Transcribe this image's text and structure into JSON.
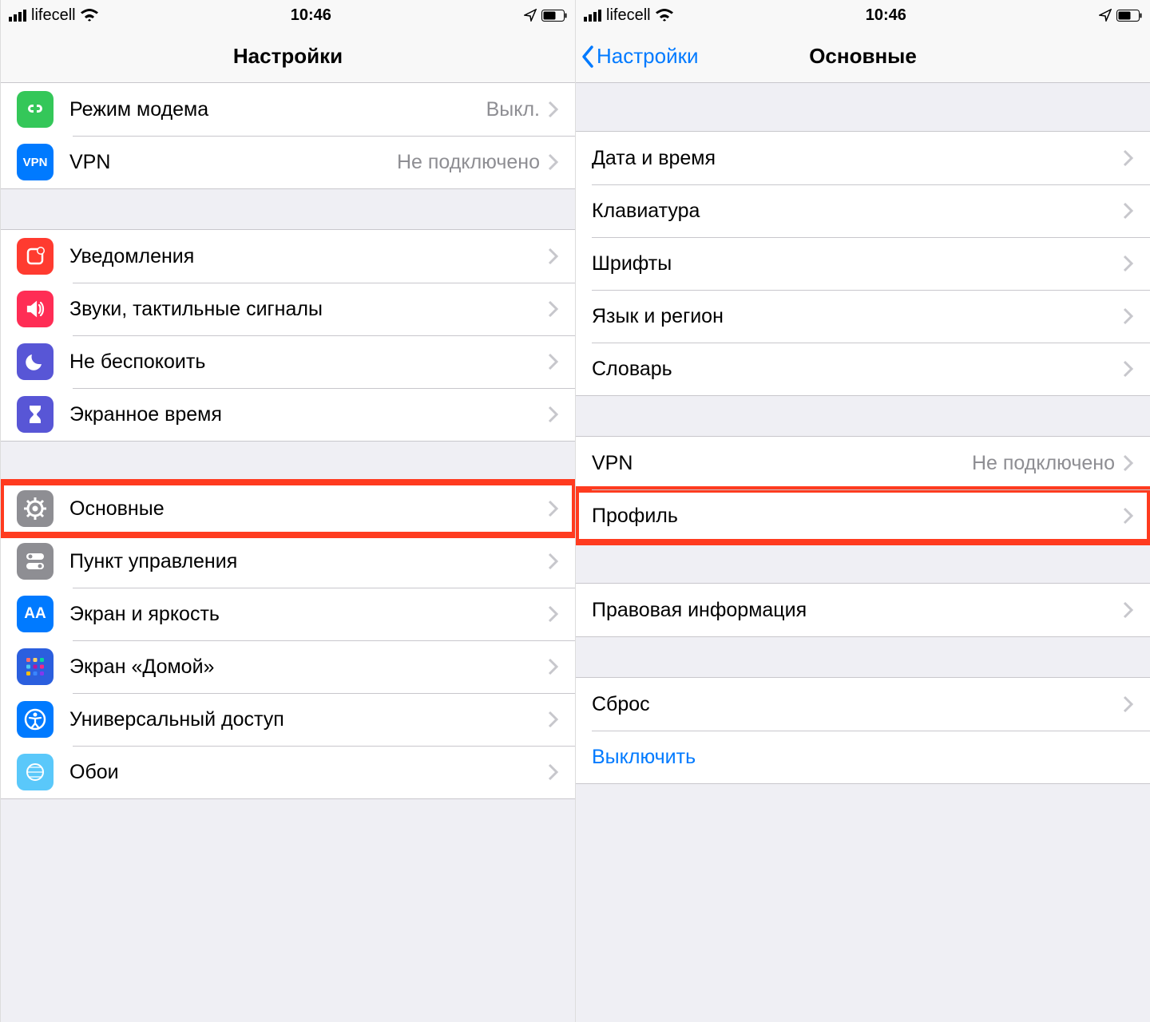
{
  "status": {
    "carrier": "lifecell",
    "time": "10:46"
  },
  "left": {
    "title": "Настройки",
    "items": {
      "hotspot": {
        "label": "Режим модема",
        "value": "Выкл."
      },
      "vpn": {
        "label": "VPN",
        "value": "Не подключено"
      },
      "notif": {
        "label": "Уведомления"
      },
      "sounds": {
        "label": "Звуки, тактильные сигналы"
      },
      "dnd": {
        "label": "Не беспокоить"
      },
      "screentime": {
        "label": "Экранное время"
      },
      "general": {
        "label": "Основные"
      },
      "control": {
        "label": "Пункт управления"
      },
      "display": {
        "label": "Экран и яркость"
      },
      "home": {
        "label": "Экран «Домой»"
      },
      "accessibility": {
        "label": "Универсальный доступ"
      },
      "wallpaper": {
        "label": "Обои"
      }
    }
  },
  "right": {
    "back": "Настройки",
    "title": "Основные",
    "items": {
      "datetime": {
        "label": "Дата и время"
      },
      "keyboard": {
        "label": "Клавиатура"
      },
      "fonts": {
        "label": "Шрифты"
      },
      "lang": {
        "label": "Язык и регион"
      },
      "dict": {
        "label": "Словарь"
      },
      "vpn": {
        "label": "VPN",
        "value": "Не подключено"
      },
      "profile": {
        "label": "Профиль"
      },
      "legal": {
        "label": "Правовая информация"
      },
      "reset": {
        "label": "Сброс"
      },
      "shutdown": {
        "label": "Выключить"
      }
    }
  }
}
